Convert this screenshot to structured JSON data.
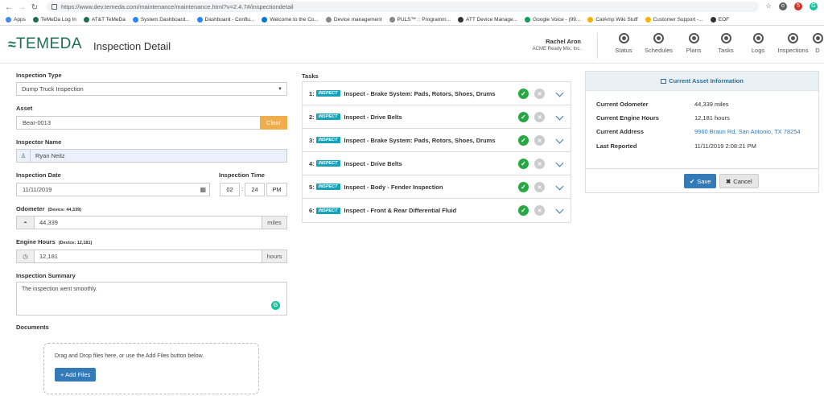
{
  "browser": {
    "url": "https://www.dev.temeda.com/maintenance/maintenance.html?v=2.4.7#/inspectiondetail",
    "bookmarks": [
      {
        "label": "Apps",
        "color": "#4285f4"
      },
      {
        "label": "TeMeDa Log In",
        "color": "#1f6e54"
      },
      {
        "label": "AT&T TeMeDa",
        "color": "#1f6e54"
      },
      {
        "label": "System Dashboard...",
        "color": "#2684ff"
      },
      {
        "label": "Dashboard - Conflu...",
        "color": "#2684ff"
      },
      {
        "label": "Welcome to the Co...",
        "color": "#0078d4"
      },
      {
        "label": "Device management",
        "color": "#888888"
      },
      {
        "label": "PULS™ :: Programm...",
        "color": "#888888"
      },
      {
        "label": "ATT Device Manage...",
        "color": "#333333"
      },
      {
        "label": "Google Voice - (99...",
        "color": "#0f9d58"
      },
      {
        "label": "CalAmp Wiki Stuff",
        "color": "#f4b400"
      },
      {
        "label": "Customer Support -...",
        "color": "#f4b400"
      },
      {
        "label": "EOF",
        "color": "#333333"
      }
    ]
  },
  "header": {
    "logo": "TEMEDA",
    "title": "Inspection Detail",
    "user_name": "Rachel Aron",
    "user_org": "ACME Ready Mix, Inc.",
    "nav": [
      "Status",
      "Schedules",
      "Plans",
      "Tasks",
      "Logs",
      "Inspections",
      "D"
    ]
  },
  "form": {
    "inspection_type_label": "Inspection Type",
    "inspection_type_value": "Dump Truck Inspection",
    "asset_label": "Asset",
    "asset_value": "Bear-0013",
    "clear_label": "Clear",
    "inspector_label": "Inspector Name",
    "inspector_value": "Ryan Neitz",
    "date_label": "Inspection Date",
    "date_value": "11/11/2019",
    "time_label": "Inspection Time",
    "time_hour": "02",
    "time_minute": "24",
    "time_ampm": "PM",
    "odometer_label": "Odometer",
    "odometer_device": "(Device: 44,339)",
    "odometer_value": "44,339",
    "odometer_unit": "miles",
    "engine_label": "Engine Hours",
    "engine_device": "(Device: 12,181)",
    "engine_value": "12,181",
    "engine_unit": "hours",
    "summary_label": "Inspection Summary",
    "summary_value": "The inspection went smoothly.",
    "documents_label": "Documents",
    "dropzone_text": "Drag and Drop files here, or use the Add Files button below.",
    "add_files_label": "+ Add Files"
  },
  "tasks": {
    "label": "Tasks",
    "badge": "INSPECT",
    "items": [
      {
        "num": "1:",
        "title": "Inspect - Brake System: Pads, Rotors, Shoes, Drums"
      },
      {
        "num": "2:",
        "title": "Inspect - Drive Belts"
      },
      {
        "num": "3:",
        "title": "Inspect - Brake System: Pads, Rotors, Shoes, Drums"
      },
      {
        "num": "4:",
        "title": "Inspect - Drive Belts"
      },
      {
        "num": "5:",
        "title": "Inspect - Body - Fender Inspection"
      },
      {
        "num": "6:",
        "title": "Inspect - Front & Rear Differential Fluid"
      }
    ]
  },
  "asset_info": {
    "title": "Current Asset Information",
    "rows": [
      {
        "key": "Current Odometer",
        "value": "44,339 miles"
      },
      {
        "key": "Current Engine Hours",
        "value": "12,181 hours"
      },
      {
        "key": "Current Address",
        "value": "9960 Braun Rd, San Antonio, TX 78254"
      },
      {
        "key": "Last Reported",
        "value": "11/11/2019 2:08:21 PM"
      }
    ],
    "save_label": "Save",
    "cancel_label": "Cancel"
  },
  "colors": {
    "brand_green": "#1f6e54",
    "primary_blue": "#337ab7",
    "clear_orange": "#f0ad4e",
    "inspect_badge": "#17a2b8",
    "success_green": "#28a745"
  }
}
